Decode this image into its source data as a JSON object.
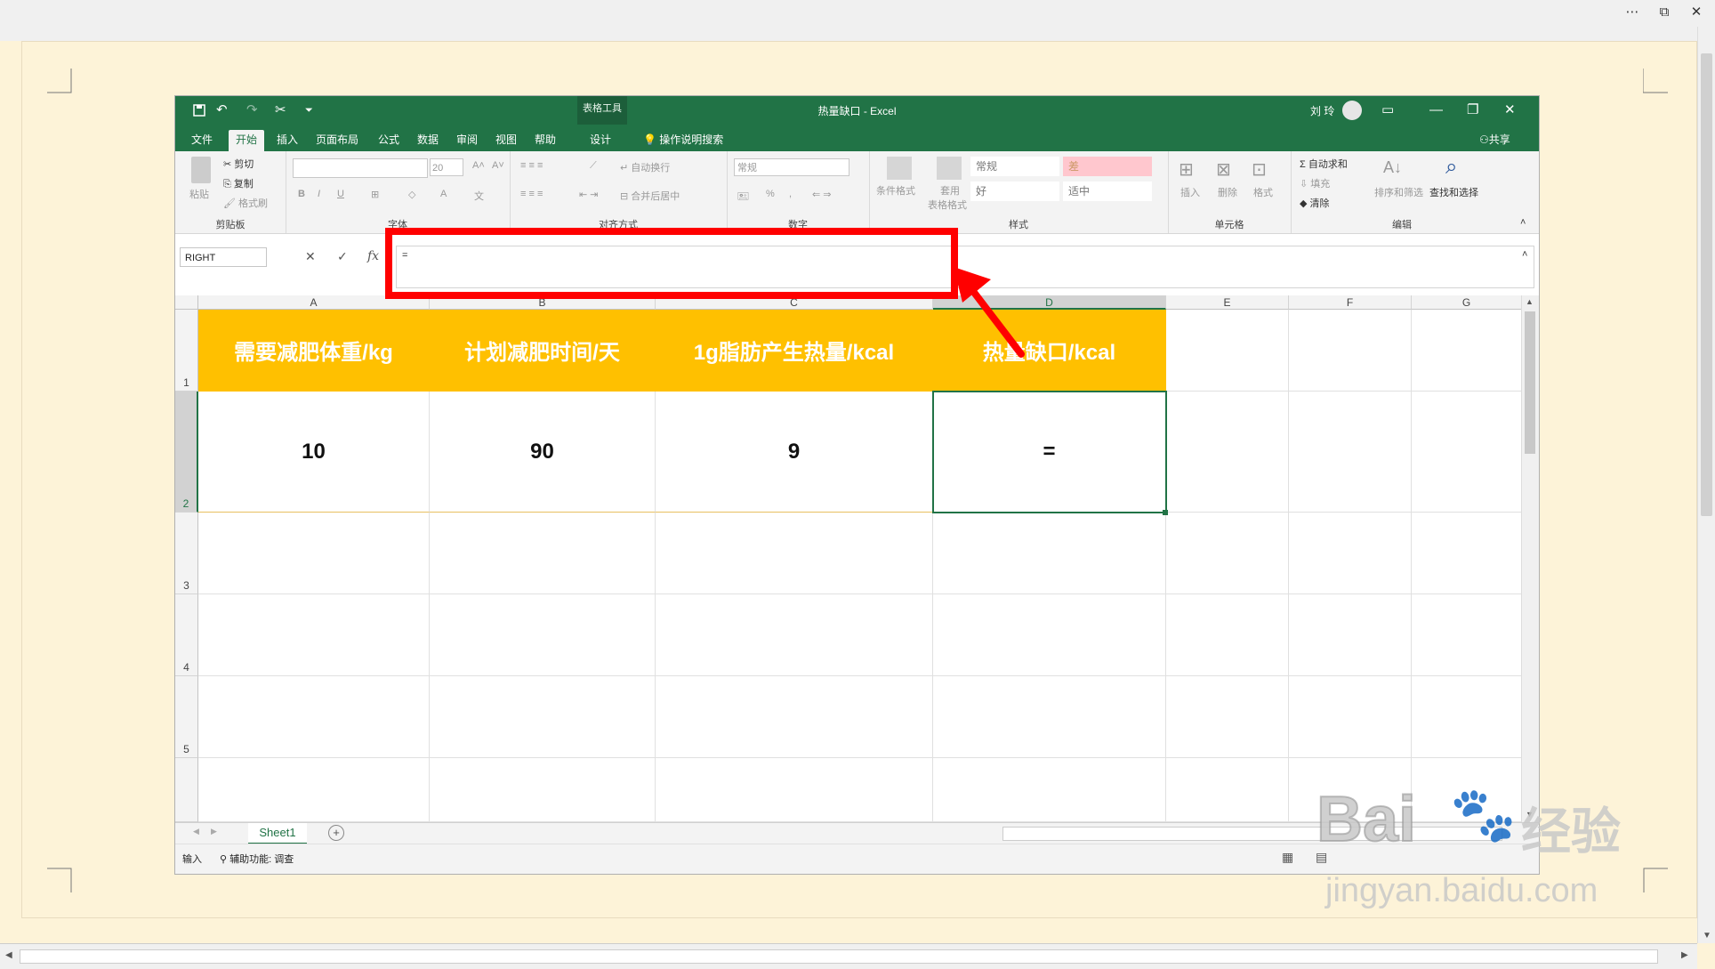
{
  "viewer": {
    "more_icon": "⋯",
    "restore_icon": "⧉",
    "close_icon": "✕"
  },
  "excel": {
    "doc_title": "热量缺口  -  Excel",
    "context_tool": "表格工具",
    "user": "刘 玲",
    "window_icons": {
      "ribbon_display": "▭",
      "minimize": "—",
      "restore": "❐",
      "close": "✕"
    },
    "tabs": [
      "文件",
      "开始",
      "插入",
      "页面布局",
      "公式",
      "数据",
      "审阅",
      "视图",
      "帮助",
      "设计"
    ],
    "active_tab": "开始",
    "tell_me": "操作说明搜索",
    "share": "共享"
  },
  "ribbon": {
    "clipboard": {
      "paste": "粘贴",
      "cut": "剪切",
      "copy": "复制",
      "format_painter": "格式刷",
      "label": "剪贴板"
    },
    "font": {
      "size": "20",
      "label": "字体",
      "bold": "B",
      "italic": "I",
      "underline": "U"
    },
    "alignment": {
      "wrap": "自动换行",
      "merge": "合并后居中",
      "label": "对齐方式"
    },
    "number": {
      "format": "常规",
      "percent": "%",
      "label": "数字"
    },
    "styles": {
      "conditional": "条件格式",
      "table_format_1": "套用",
      "table_format_2": "表格格式",
      "normal": "常规",
      "bad": "差",
      "good": "好",
      "neutral": "适中",
      "label": "样式"
    },
    "cells": {
      "insert": "插入",
      "delete": "删除",
      "format": "格式",
      "label": "单元格"
    },
    "editing": {
      "autosum": "自动求和",
      "fill": "填充",
      "clear": "清除",
      "sort": "排序和筛选",
      "find": "查找和选择",
      "label": "编辑"
    }
  },
  "formula_bar": {
    "name_box": "RIGHT",
    "cancel": "✕",
    "enter": "✓",
    "fx": "fx",
    "content": "="
  },
  "sheet": {
    "columns": [
      "A",
      "B",
      "C",
      "D",
      "E",
      "F",
      "G"
    ],
    "rows": [
      "1",
      "2",
      "3",
      "4",
      "5"
    ],
    "headers": [
      "需要减肥体重/kg",
      "计划减肥时间/天",
      "1g脂肪产生热量/kcal",
      "热量缺口/kcal"
    ],
    "values": [
      "10",
      "90",
      "9",
      "="
    ],
    "active_cell": "D2",
    "tab_name": "Sheet1",
    "add_sheet": "+"
  },
  "status": {
    "mode": "输入",
    "accessibility": "辅助功能: 调查"
  },
  "watermark": {
    "brand": "Bai",
    "brand_cn": "经验",
    "url": "jingyan.baidu.com"
  },
  "colors": {
    "excel_green": "#217346",
    "header_fill": "#ffc000",
    "annotation_red": "#ff0000",
    "page_bg": "#fdf3d8"
  }
}
